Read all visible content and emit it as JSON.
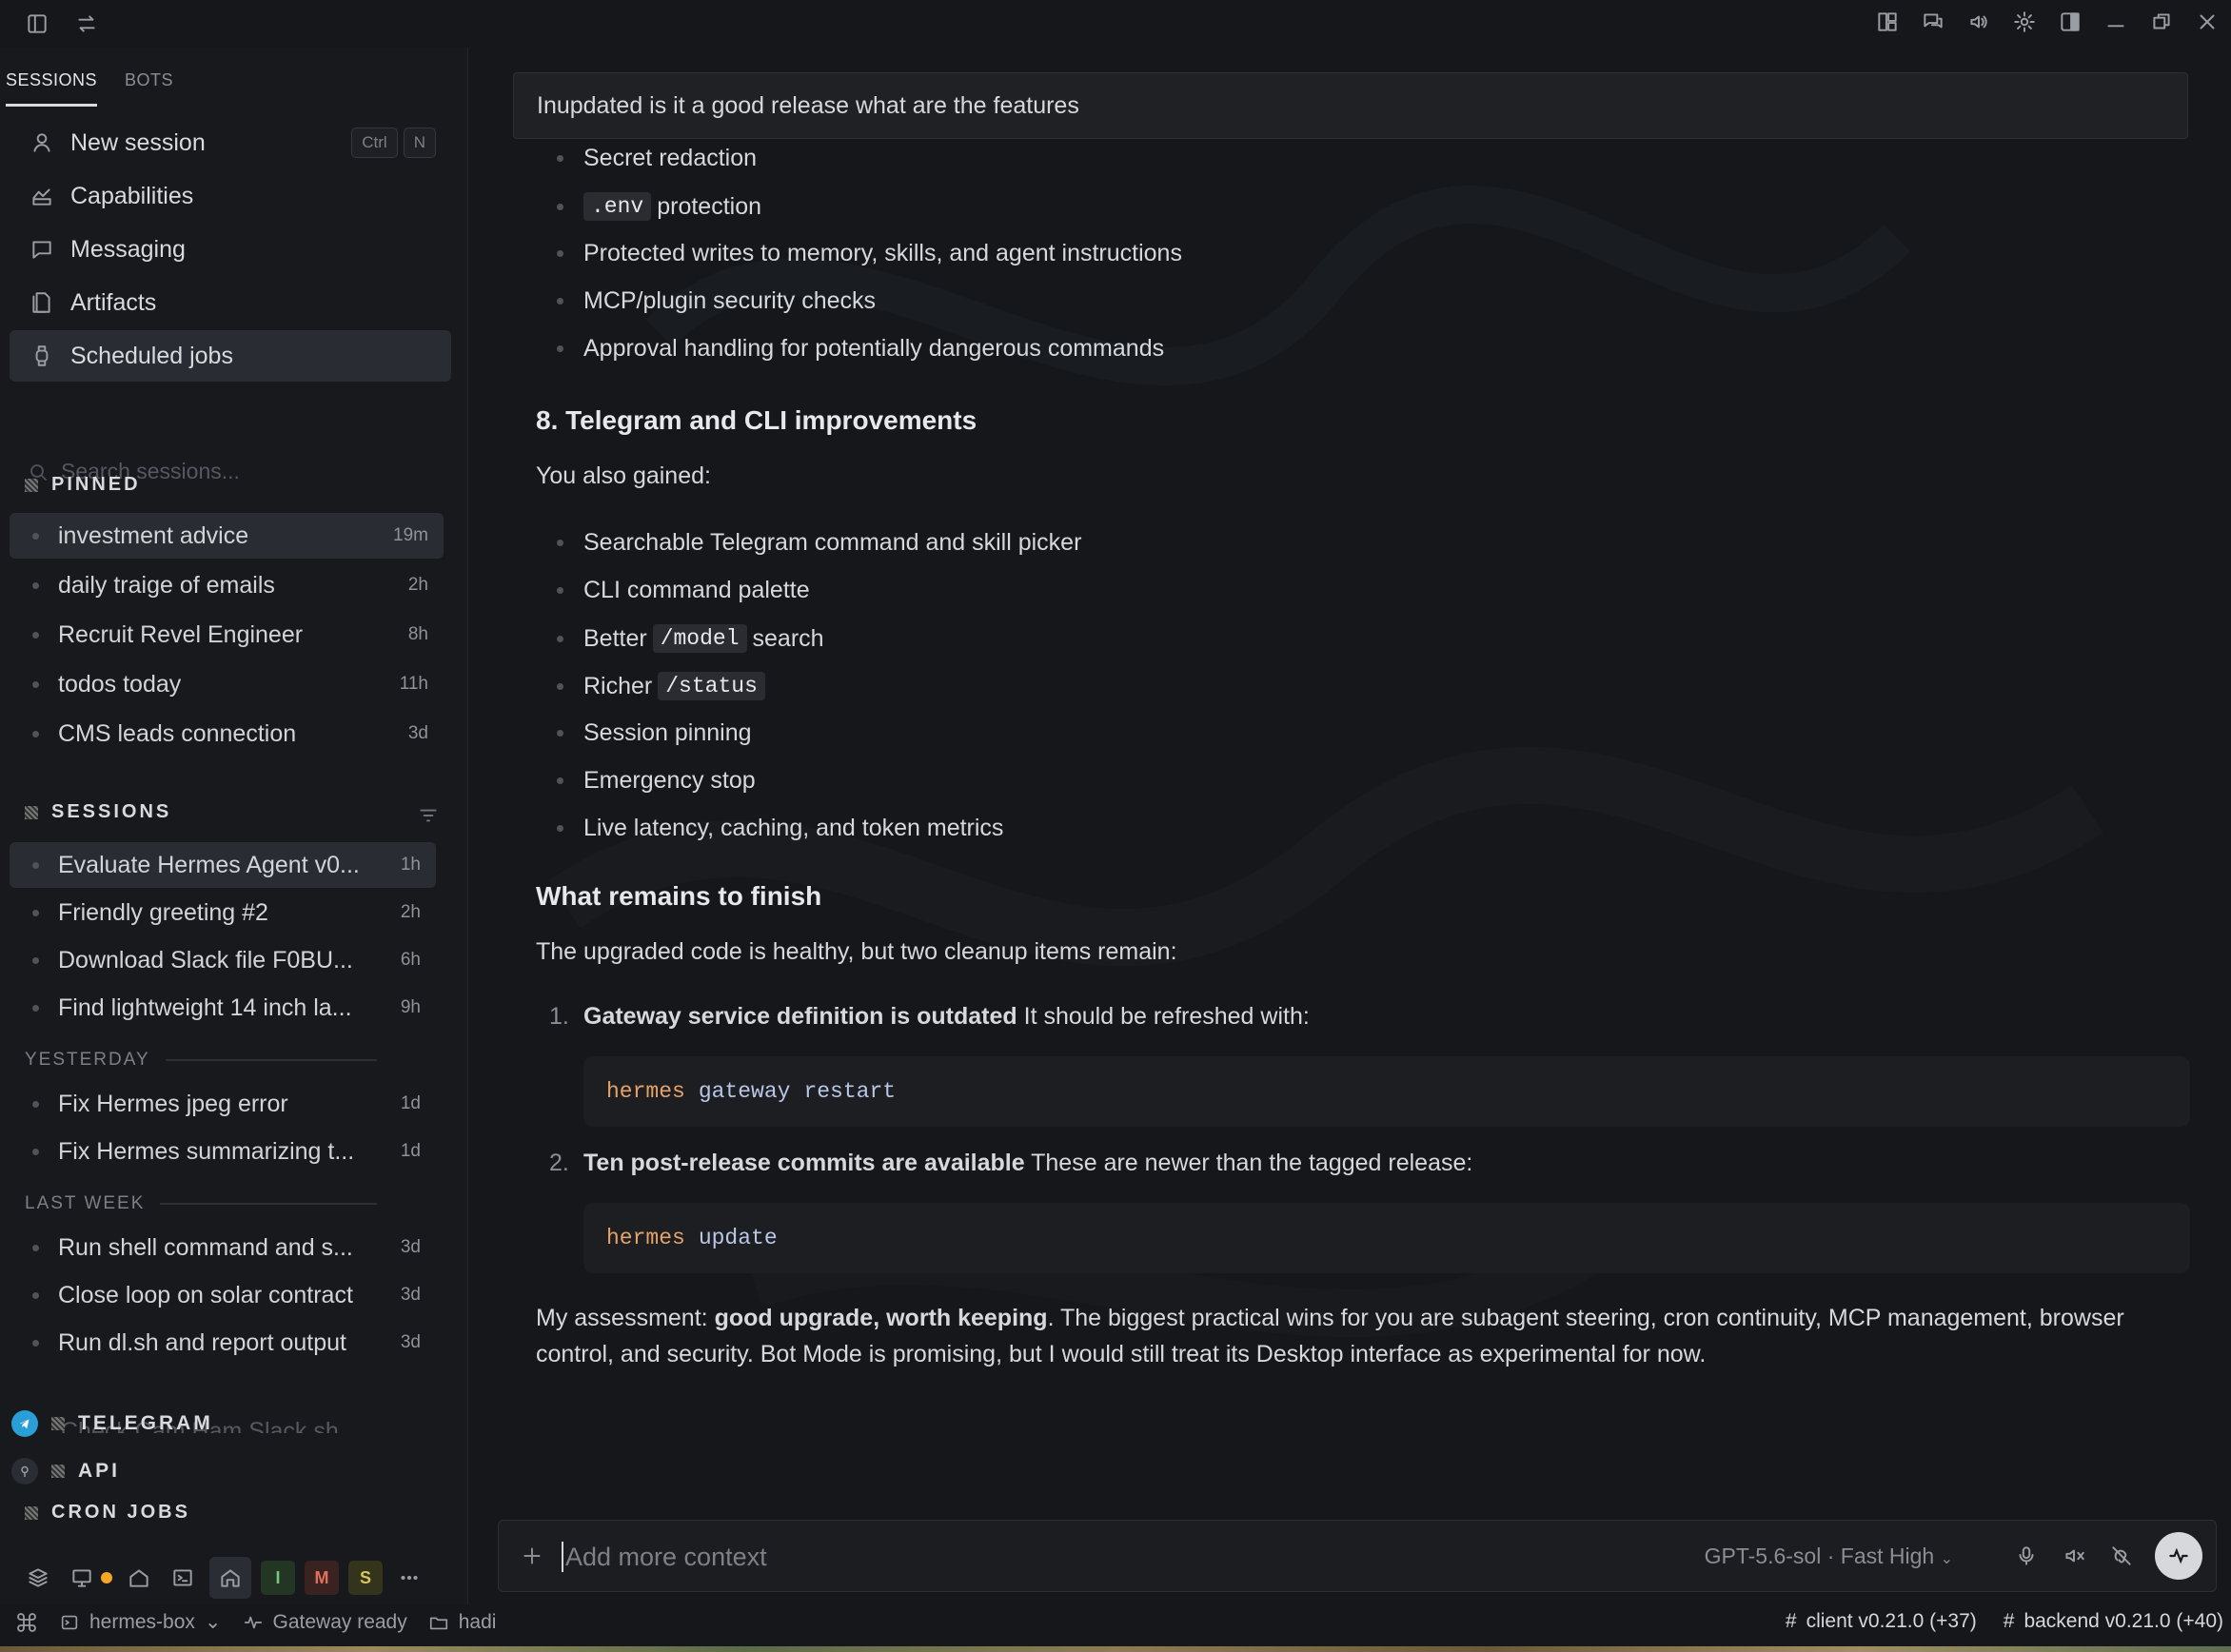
{
  "sidebar": {
    "tabs": [
      "SESSIONS",
      "BOTS"
    ],
    "nav": [
      {
        "label": "New session",
        "icon": "user-icon"
      },
      {
        "label": "Capabilities",
        "icon": "capabilities-icon"
      },
      {
        "label": "Messaging",
        "icon": "message-icon"
      },
      {
        "label": "Artifacts",
        "icon": "document-icon"
      },
      {
        "label": "Scheduled jobs",
        "icon": "watch-icon"
      }
    ],
    "shortcut": [
      "Ctrl",
      "N"
    ],
    "search_placeholder": "Search sessions...",
    "pinned_title": "PINNED",
    "pinned": [
      {
        "title": "investment advice",
        "age": "19m"
      },
      {
        "title": "daily traige of emails",
        "age": "2h"
      },
      {
        "title": "Recruit Revel Engineer",
        "age": "8h"
      },
      {
        "title": "todos today",
        "age": "11h"
      },
      {
        "title": "CMS leads connection",
        "age": "3d"
      }
    ],
    "sessions_title": "SESSIONS",
    "sessions_recent": [
      {
        "title": "Evaluate Hermes Agent v0...",
        "age": "1h"
      },
      {
        "title": "Friendly greeting #2",
        "age": "2h"
      },
      {
        "title": "Download Slack file F0BU...",
        "age": "6h"
      },
      {
        "title": "Find lightweight 14 inch la...",
        "age": "9h"
      }
    ],
    "yesterday_title": "YESTERDAY",
    "sessions_yesterday": [
      {
        "title": "Fix Hermes jpeg error",
        "age": "1d"
      },
      {
        "title": "Fix Hermes summarizing t...",
        "age": "1d"
      }
    ],
    "last_week_title": "LAST WEEK",
    "sessions_last_week": [
      {
        "title": "Run shell command and s...",
        "age": "3d"
      },
      {
        "title": "Close loop on solar contract",
        "age": "3d"
      },
      {
        "title": "Run dl.sh and report output",
        "age": "3d"
      }
    ],
    "cut_off_item": "Check Cam Ham Slack sh...",
    "bottom_groups": [
      "TELEGRAM",
      "API",
      "CRON JOBS"
    ],
    "dock_chips": [
      {
        "letter": "I",
        "bg": "#233523",
        "fg": "#7bc47b"
      },
      {
        "letter": "M",
        "bg": "#3a2220",
        "fg": "#e0715f"
      },
      {
        "letter": "S",
        "bg": "#34331c",
        "fg": "#d7c65a"
      }
    ]
  },
  "chat": {
    "user_message": "Inupdated is it a good release what are the features",
    "security_bullets": [
      {
        "pre": "Secret redaction",
        "code": "",
        "post": ""
      },
      {
        "pre": "",
        "code": ".env",
        "post": "protection"
      },
      {
        "pre": "Protected writes to memory, skills, and agent instructions",
        "code": "",
        "post": ""
      },
      {
        "pre": "MCP/plugin security checks",
        "code": "",
        "post": ""
      },
      {
        "pre": "Approval handling for potentially dangerous commands",
        "code": "",
        "post": ""
      }
    ],
    "section8_title": "8. Telegram and CLI improvements",
    "section8_intro": "You also gained:",
    "section8_bullets": [
      {
        "pre": "Searchable Telegram command and skill picker",
        "code": "",
        "post": ""
      },
      {
        "pre": "CLI command palette",
        "code": "",
        "post": ""
      },
      {
        "pre": "Better",
        "code": "/model",
        "post": "search"
      },
      {
        "pre": "Richer",
        "code": "/status",
        "post": ""
      },
      {
        "pre": "Session pinning",
        "code": "",
        "post": ""
      },
      {
        "pre": "Emergency stop",
        "code": "",
        "post": ""
      },
      {
        "pre": "Live latency, caching, and token metrics",
        "code": "",
        "post": ""
      }
    ],
    "remains_title": "What remains to finish",
    "remains_intro": "The upgraded code is healthy, but two cleanup items remain:",
    "steps": [
      {
        "num": "1.",
        "bold": "Gateway service definition is outdated",
        "text": " It should be refreshed with:",
        "cmd": [
          "hermes",
          "gateway",
          "restart"
        ]
      },
      {
        "num": "2.",
        "bold": "Ten post-release commits are available",
        "text": " These are newer than the tagged release:",
        "cmd": [
          "hermes",
          "update"
        ]
      }
    ],
    "assessment_pre": "My assessment: ",
    "assessment_bold": "good upgrade, worth keeping",
    "assessment_post": ". The biggest practical wins for you are subagent steering, cron continuity, MCP management, browser control, and security. Bot Mode is promising, but I would still treat its Desktop interface as experimental for now."
  },
  "composer": {
    "placeholder": "Add more context",
    "model": "GPT-5.6-sol · Fast High"
  },
  "statusbar": {
    "host": "hermes-box",
    "gateway": "Gateway ready",
    "folder": "hadi",
    "client": "client v0.21.0 (+37)",
    "backend": "backend v0.21.0 (+40)"
  }
}
